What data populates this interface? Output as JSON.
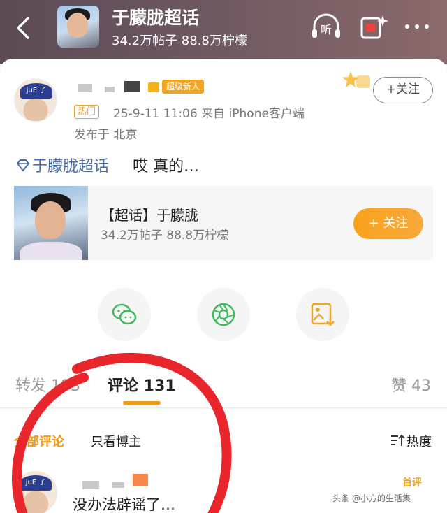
{
  "header": {
    "title": "于朦胧超话",
    "subtitle": "34.2万帖子 88.8万柠檬",
    "listen_label": "听"
  },
  "post": {
    "badge_new": "超级新人",
    "hot_tag": "热门",
    "meta": "25-9-11 11:06  来自 iPhone客户端",
    "location": "发布于 北京",
    "follow_label": "+关注",
    "topic_tag": "于朦胧超话",
    "text": "哎 真的…",
    "avatar_text": "juE 了"
  },
  "topic_card": {
    "title": "【超话】于朦胧",
    "sub": "34.2万帖子 88.8万柠檬",
    "follow_label": "+ 关注"
  },
  "tabs": {
    "repost": "转发 193",
    "comment": "评论 131",
    "like": "赞 43"
  },
  "filters": {
    "all": "全部评论",
    "only_author": "只看博主",
    "sort": "热度"
  },
  "comment": {
    "text": "没办法辟谣了…",
    "badge": "首评",
    "avatar_text": "juE 了"
  },
  "watermark": "头条 @小方的生活集",
  "colors": {
    "accent_orange": "#f39a15",
    "link_blue": "#4a6fa8",
    "share_green": "#3dbb5e"
  }
}
